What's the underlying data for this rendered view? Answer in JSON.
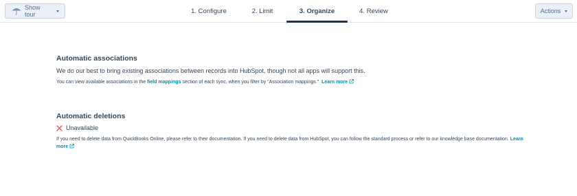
{
  "header": {
    "tour_button": "Show tour",
    "actions_button": "Actions",
    "steps": [
      {
        "label": "1. Configure"
      },
      {
        "label": "2. Limit"
      },
      {
        "label": "3. Organize"
      },
      {
        "label": "4. Review"
      }
    ],
    "active_step_index": 2
  },
  "associations": {
    "title": "Automatic associations",
    "lead": "We do our best to bring existing associations between records into HubSpot, though not all apps will support this.",
    "note_prefix": "You can view available associations in the",
    "note_link": "field mappings",
    "note_suffix": "section of each sync, when you filter by \"Association mappings.\"",
    "learn_more": "Learn more"
  },
  "deletions": {
    "title": "Automatic deletions",
    "status": "Unavailable",
    "note": "If you need to delete data from QuickBooks Online, please refer to their documentation. If you need to delete data from HubSpot, you can follow the standard process or refer to our knowledge base documentation.",
    "learn_more": "Learn more"
  },
  "colors": {
    "link": "#0091ae",
    "text": "#33475b",
    "error": "#f2545b",
    "active_tab_bar": "#213343"
  },
  "icons": {
    "tour": "umbrella-icon",
    "caret": "caret-down-icon",
    "external": "external-link-icon",
    "unavailable": "x-icon"
  }
}
